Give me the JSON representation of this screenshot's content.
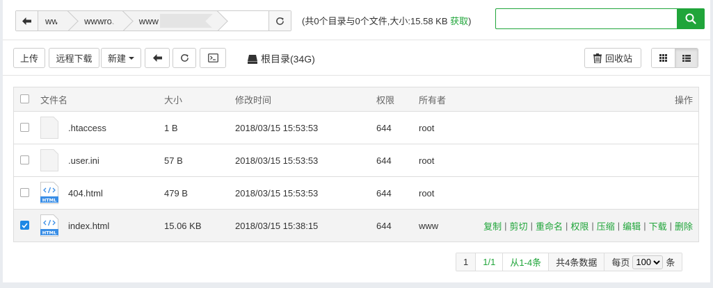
{
  "path_bar": {
    "crumbs": [
      "www",
      "wwwroot",
      "www"
    ],
    "dir_info_prefix": "(共0个目录与0个文件,大小:15.58 KB ",
    "fetch_link": "获取",
    "dir_info_suffix": ")"
  },
  "search": {
    "value": "",
    "placeholder": ""
  },
  "toolbar": {
    "upload": "上传",
    "remote_download": "远程下载",
    "new": "新建",
    "root_dir": "根目录(34G)",
    "recycle_bin": "回收站"
  },
  "table": {
    "headers": {
      "name": "文件名",
      "size": "大小",
      "time": "修改时间",
      "perm": "权限",
      "owner": "所有者",
      "ops": "操作"
    },
    "rows": [
      {
        "name": ".htaccess",
        "size": "1 B",
        "time": "2018/03/15 15:53:53",
        "perm": "644",
        "owner": "root",
        "icon": "file-icon",
        "checked": false
      },
      {
        "name": ".user.ini",
        "size": "57 B",
        "time": "2018/03/15 15:53:53",
        "perm": "644",
        "owner": "root",
        "icon": "file-icon",
        "checked": false
      },
      {
        "name": "404.html",
        "size": "479 B",
        "time": "2018/03/15 15:53:53",
        "perm": "644",
        "owner": "root",
        "icon": "html-file-icon",
        "checked": false
      },
      {
        "name": "index.html",
        "size": "15.06 KB",
        "time": "2018/03/15 15:38:15",
        "perm": "644",
        "owner": "www",
        "icon": "html-file-icon",
        "checked": true
      }
    ],
    "row_ops": [
      "复制",
      "剪切",
      "重命名",
      "权限",
      "压缩",
      "编辑",
      "下载",
      "删除"
    ]
  },
  "pager": {
    "current": "1",
    "pages": "1/1",
    "range": "从1-4条",
    "total": "共4条数据",
    "per_page_label": "每页",
    "per_page_value": "100",
    "per_page_unit": "条"
  },
  "colors": {
    "accent": "#20a53a",
    "checkbox": "#1e88e5"
  }
}
